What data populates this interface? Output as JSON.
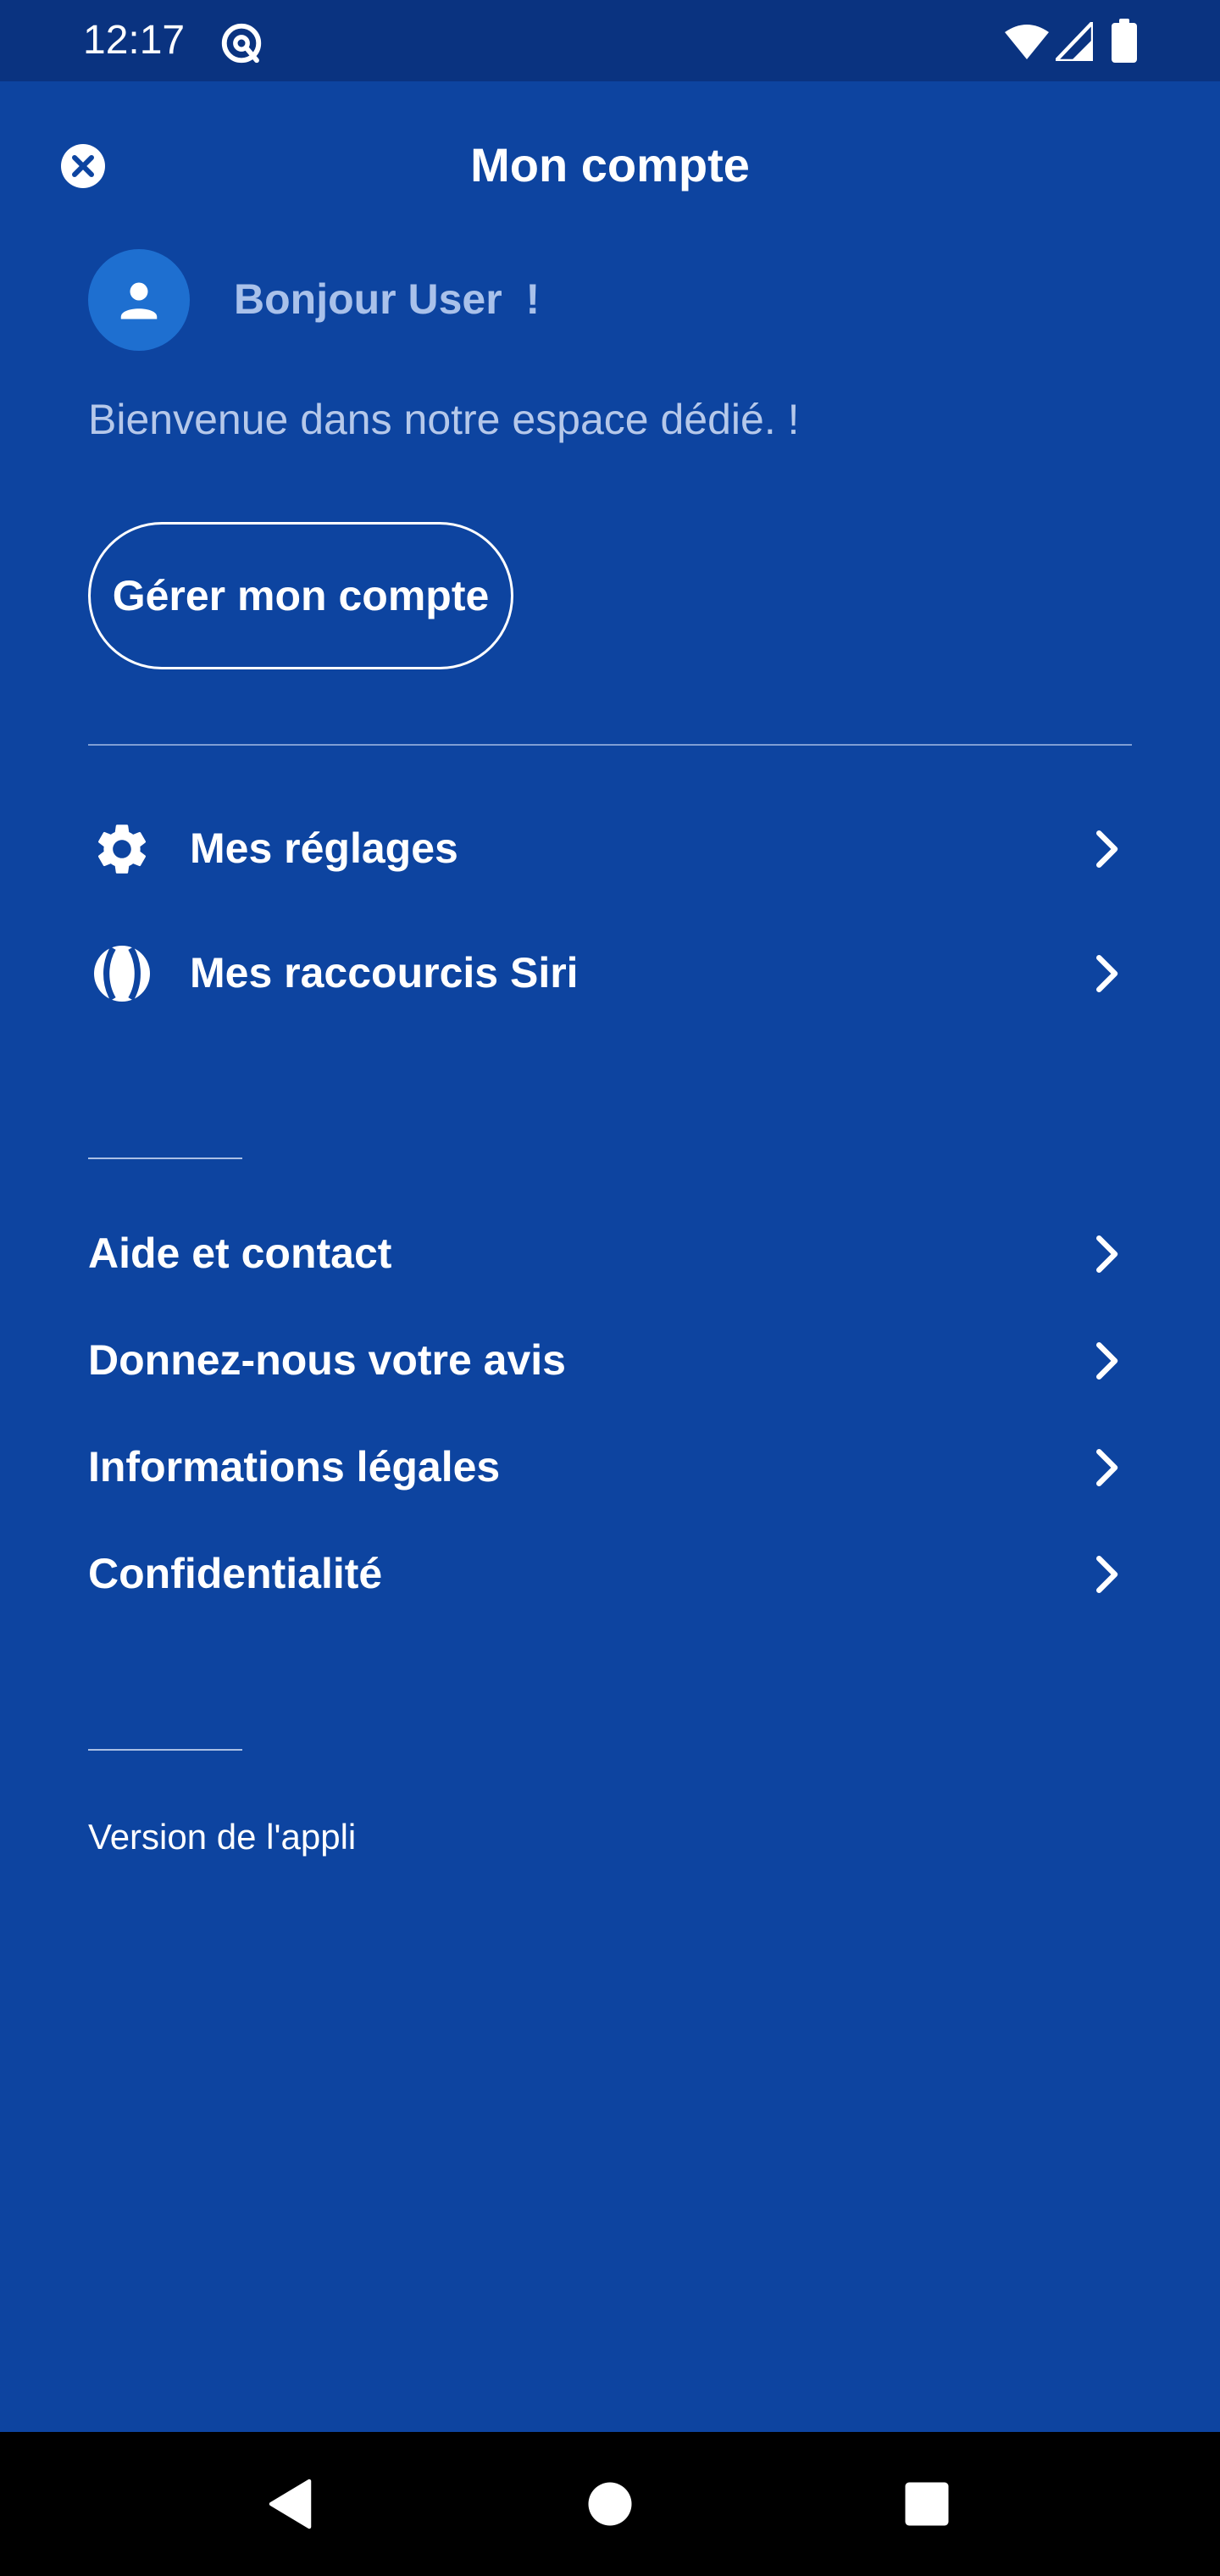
{
  "status_bar": {
    "time": "12:17",
    "icons": [
      "at-sign-icon",
      "wifi-icon",
      "cellular-signal-icon",
      "battery-icon"
    ]
  },
  "header": {
    "title": "Mon compte",
    "close_icon": "close-circle-icon"
  },
  "profile": {
    "avatar_icon": "person-icon",
    "greeting": "Bonjour User  !",
    "welcome": "Bienvenue dans notre espace dédié. !",
    "manage_button_label": "Gérer mon compte"
  },
  "settings_menu": [
    {
      "icon": "gear-icon",
      "label": "Mes réglages"
    },
    {
      "icon": "siri-shortcuts-icon",
      "label": "Mes raccourcis Siri"
    }
  ],
  "info_menu": [
    {
      "label": "Aide et contact"
    },
    {
      "label": "Donnez-nous votre avis"
    },
    {
      "label": "Informations légales"
    },
    {
      "label": "Confidentialité"
    }
  ],
  "footer": {
    "version_label": "Version de l'appli"
  },
  "nav_bar": {
    "icons": [
      "back-triangle-icon",
      "home-circle-icon",
      "recents-square-icon"
    ]
  },
  "colors": {
    "background": "#0d44a0",
    "status_bar": "#0a3380",
    "avatar": "#1e6fd0",
    "greeting_text": "#a9c1ea",
    "nav_bar": "#000000"
  }
}
